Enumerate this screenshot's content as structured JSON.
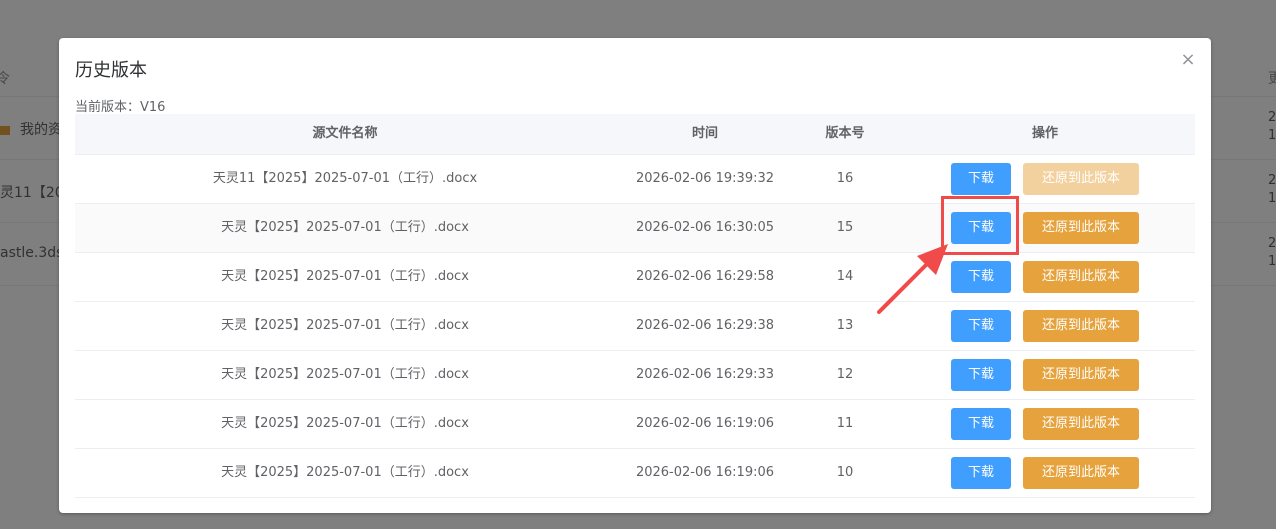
{
  "background": {
    "header_left": "令",
    "header_right": "更",
    "rows": [
      {
        "left": "我的资",
        "right_line1": "2",
        "right_line2": "1",
        "has_folder": true
      },
      {
        "left": "灵11【20",
        "right_line1": "2",
        "right_line2": "1",
        "has_folder": false
      },
      {
        "left": "astle.3ds",
        "right_line1": "2",
        "right_line2": "1",
        "has_folder": false
      }
    ]
  },
  "dialog": {
    "title": "历史版本",
    "close_symbol": "×",
    "current_version_label": "当前版本：V16",
    "columns": {
      "name": "源文件名称",
      "time": "时间",
      "version": "版本号",
      "actions": "操作"
    },
    "download_label": "下载",
    "restore_label": "还原到此版本",
    "rows": [
      {
        "name": "天灵11【2025】2025-07-01（工行）.docx",
        "time": "2026-02-06 19:39:32",
        "version": "16",
        "restore_disabled": true
      },
      {
        "name": "天灵【2025】2025-07-01（工行）.docx",
        "time": "2026-02-06 16:30:05",
        "version": "15",
        "restore_disabled": false
      },
      {
        "name": "天灵【2025】2025-07-01（工行）.docx",
        "time": "2026-02-06 16:29:58",
        "version": "14",
        "restore_disabled": false
      },
      {
        "name": "天灵【2025】2025-07-01（工行）.docx",
        "time": "2026-02-06 16:29:38",
        "version": "13",
        "restore_disabled": false
      },
      {
        "name": "天灵【2025】2025-07-01（工行）.docx",
        "time": "2026-02-06 16:29:33",
        "version": "12",
        "restore_disabled": false
      },
      {
        "name": "天灵【2025】2025-07-01（工行）.docx",
        "time": "2026-02-06 16:19:06",
        "version": "11",
        "restore_disabled": false
      },
      {
        "name": "天灵【2025】2025-07-01（工行）.docx",
        "time": "2026-02-06 16:19:06",
        "version": "10",
        "restore_disabled": false
      }
    ]
  },
  "annotation": {
    "highlight_color": "#f04a4a",
    "target": "download-button row 15"
  },
  "colors": {
    "primary": "#409eff",
    "warning": "#e6a23c",
    "warning_disabled": "#f3d19e"
  }
}
